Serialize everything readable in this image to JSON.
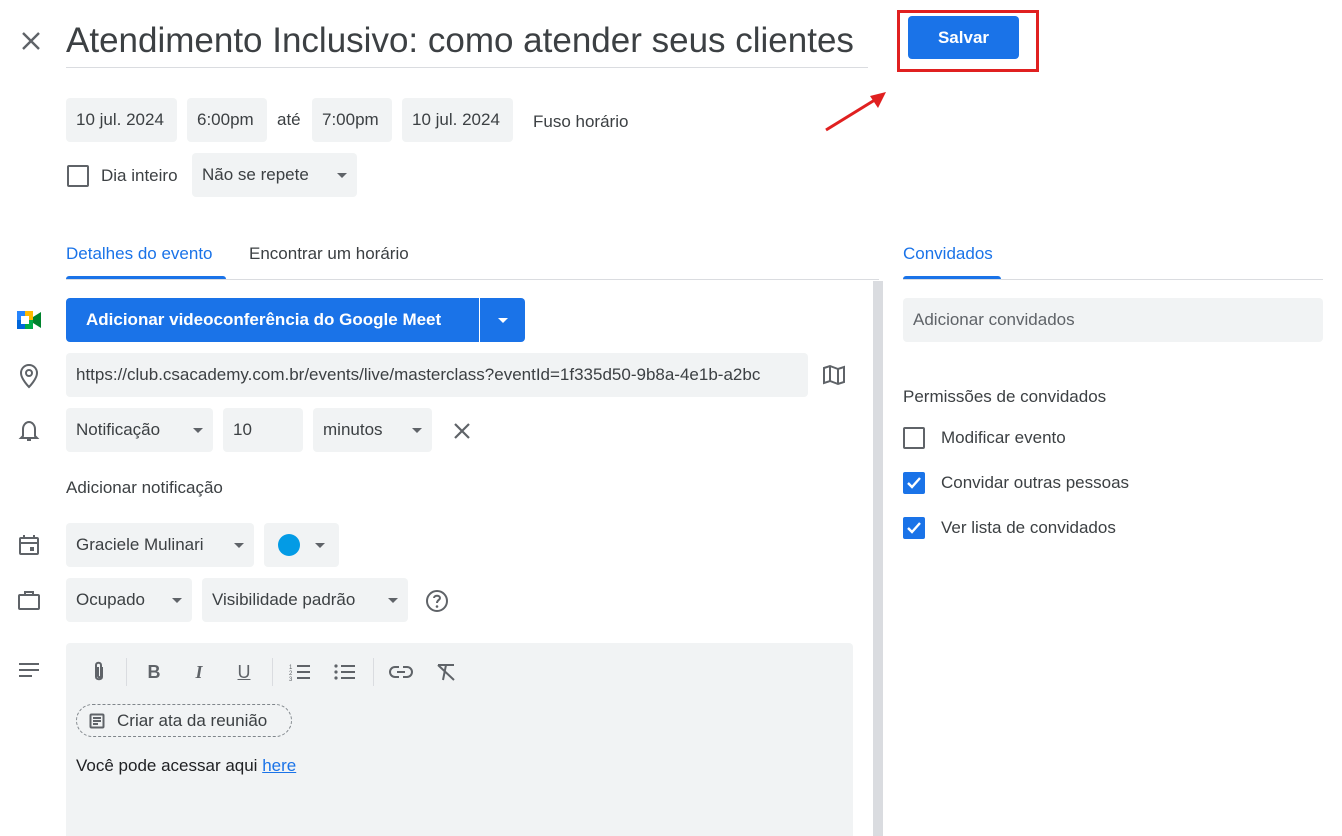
{
  "header": {
    "title": "Atendimento Inclusivo: como atender seus clientes",
    "save_label": "Salvar"
  },
  "datetime": {
    "start_date": "10 jul. 2024",
    "start_time": "6:00pm",
    "to_label": "até",
    "end_time": "7:00pm",
    "end_date": "10 jul. 2024",
    "timezone_label": "Fuso horário",
    "all_day_label": "Dia inteiro",
    "repeat_value": "Não se repete"
  },
  "tabs": {
    "details": "Detalhes do evento",
    "find_time": "Encontrar um horário",
    "guests": "Convidados"
  },
  "meet": {
    "button_label": "Adicionar videoconferência do Google Meet"
  },
  "location": {
    "value": "https://club.csacademy.com.br/events/live/masterclass?eventId=1f335d50-9b8a-4e1b-a2bc"
  },
  "notification": {
    "type": "Notificação",
    "amount": "10",
    "unit": "minutos",
    "add_label": "Adicionar notificação"
  },
  "calendar": {
    "owner": "Graciele Mulinari",
    "color": "#039be5"
  },
  "availability": {
    "status": "Ocupado",
    "visibility": "Visibilidade padrão"
  },
  "description": {
    "notes_button": "Criar ata da reunião",
    "text": "Você pode acessar aqui ",
    "link_text": "here",
    "toolbar_icons": [
      "attachment-icon",
      "bold-icon",
      "italic-icon",
      "underline-icon",
      "numbered-list-icon",
      "bulleted-list-icon",
      "link-icon",
      "clear-format-icon"
    ]
  },
  "guests": {
    "add_placeholder": "Adicionar convidados",
    "permissions_title": "Permissões de convidados",
    "permissions": [
      {
        "label": "Modificar evento",
        "checked": false
      },
      {
        "label": "Convidar outras pessoas",
        "checked": true
      },
      {
        "label": "Ver lista de convidados",
        "checked": true
      }
    ]
  },
  "colors": {
    "accent": "#1a73e8",
    "annotation_red": "#e02020",
    "chip_bg": "#f1f3f4"
  }
}
